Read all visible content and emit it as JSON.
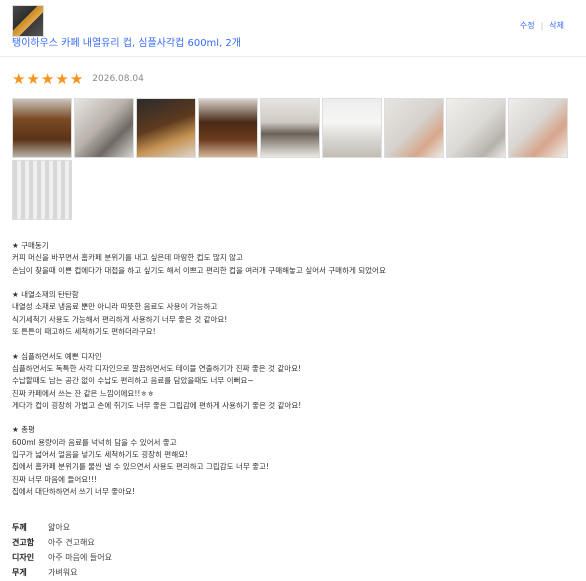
{
  "product": {
    "name": "탱이하우스 카페 내열유리 컵, 심플사각컵 600ml, 2개"
  },
  "actions": {
    "edit": "수정",
    "delete": "삭제"
  },
  "rating": {
    "stars": 5,
    "max": 5,
    "date": "2026.08.04"
  },
  "photos": [
    {
      "icon": "photo-1"
    },
    {
      "icon": "photo-2"
    },
    {
      "icon": "photo-3"
    },
    {
      "icon": "photo-4"
    },
    {
      "icon": "photo-5"
    },
    {
      "icon": "photo-6"
    },
    {
      "icon": "photo-7"
    },
    {
      "icon": "photo-8"
    },
    {
      "icon": "photo-9"
    },
    {
      "icon": "photo-10"
    }
  ],
  "review_lines": [
    "★ 구매동기",
    "커피 머신을 바꾸면서 홈카페 분위기를 내고 싶은데 마땅한 컵도 많지 않고",
    "손님이 찾을때 이쁜 컵에다가 대접을 하고 싶기도 해서 이쁘고 편리한 컵을 여러개 구매해놓고 싶어서 구매하게 되었어요",
    "",
    "★ 내열소재의 탄탄함",
    "내열성 소재로 냉음료 뿐만 아니라 따뜻한 음료도 사용이 가능하고",
    "식기세척기 사용도 가능해서 편리하게 사용하기 너무 좋은 것 같아요!",
    "또 튼튼이 때고하드 세척하기도 편하더라구요!",
    "",
    "★ 심플하면서도 예쁜 디자인",
    "심플하면서도 독특한 사각 디자인으로 깔끔하면서도 테이블 연출하기가 진짜 좋은 것 같아요!",
    "수납할때도 남는 공간 없이 수납도 편리하고 음료를 담았을때도 너무 이뻐요~",
    "진짜 카페에서 쓰는 잔 같은 느낌이에요!!ㅎㅎ",
    "게다가 컵이 굉장히 가볍고 손에 쥐기도 너무 좋은 그립감에 편하게 사용하기 좋은 것 같아요!",
    "",
    "★ 총평",
    "600ml 용량이라 음료를 넉넉히 담을 수 있어서 좋고",
    "입구가 넓어서 얼음을 넣기도 세척하기도 굉장히 편해요!",
    "집에서 홈카페 분위기를 물씬 낼 수 있으면서 사용도 편리하고 그립감도 너무 좋고!",
    "진짜 너무 마음에 들어요!!!",
    "집에서 대단하하면서 쓰기 너무 좋아요!"
  ],
  "survey": [
    {
      "key": "두께",
      "value": "얇아요"
    },
    {
      "key": "견고함",
      "value": "아주 견고해요"
    },
    {
      "key": "디자인",
      "value": "아주 마음에 들어요"
    },
    {
      "key": "무게",
      "value": "가벼워요"
    }
  ],
  "colors": {
    "link": "#346aff",
    "star": "#f7941d"
  }
}
